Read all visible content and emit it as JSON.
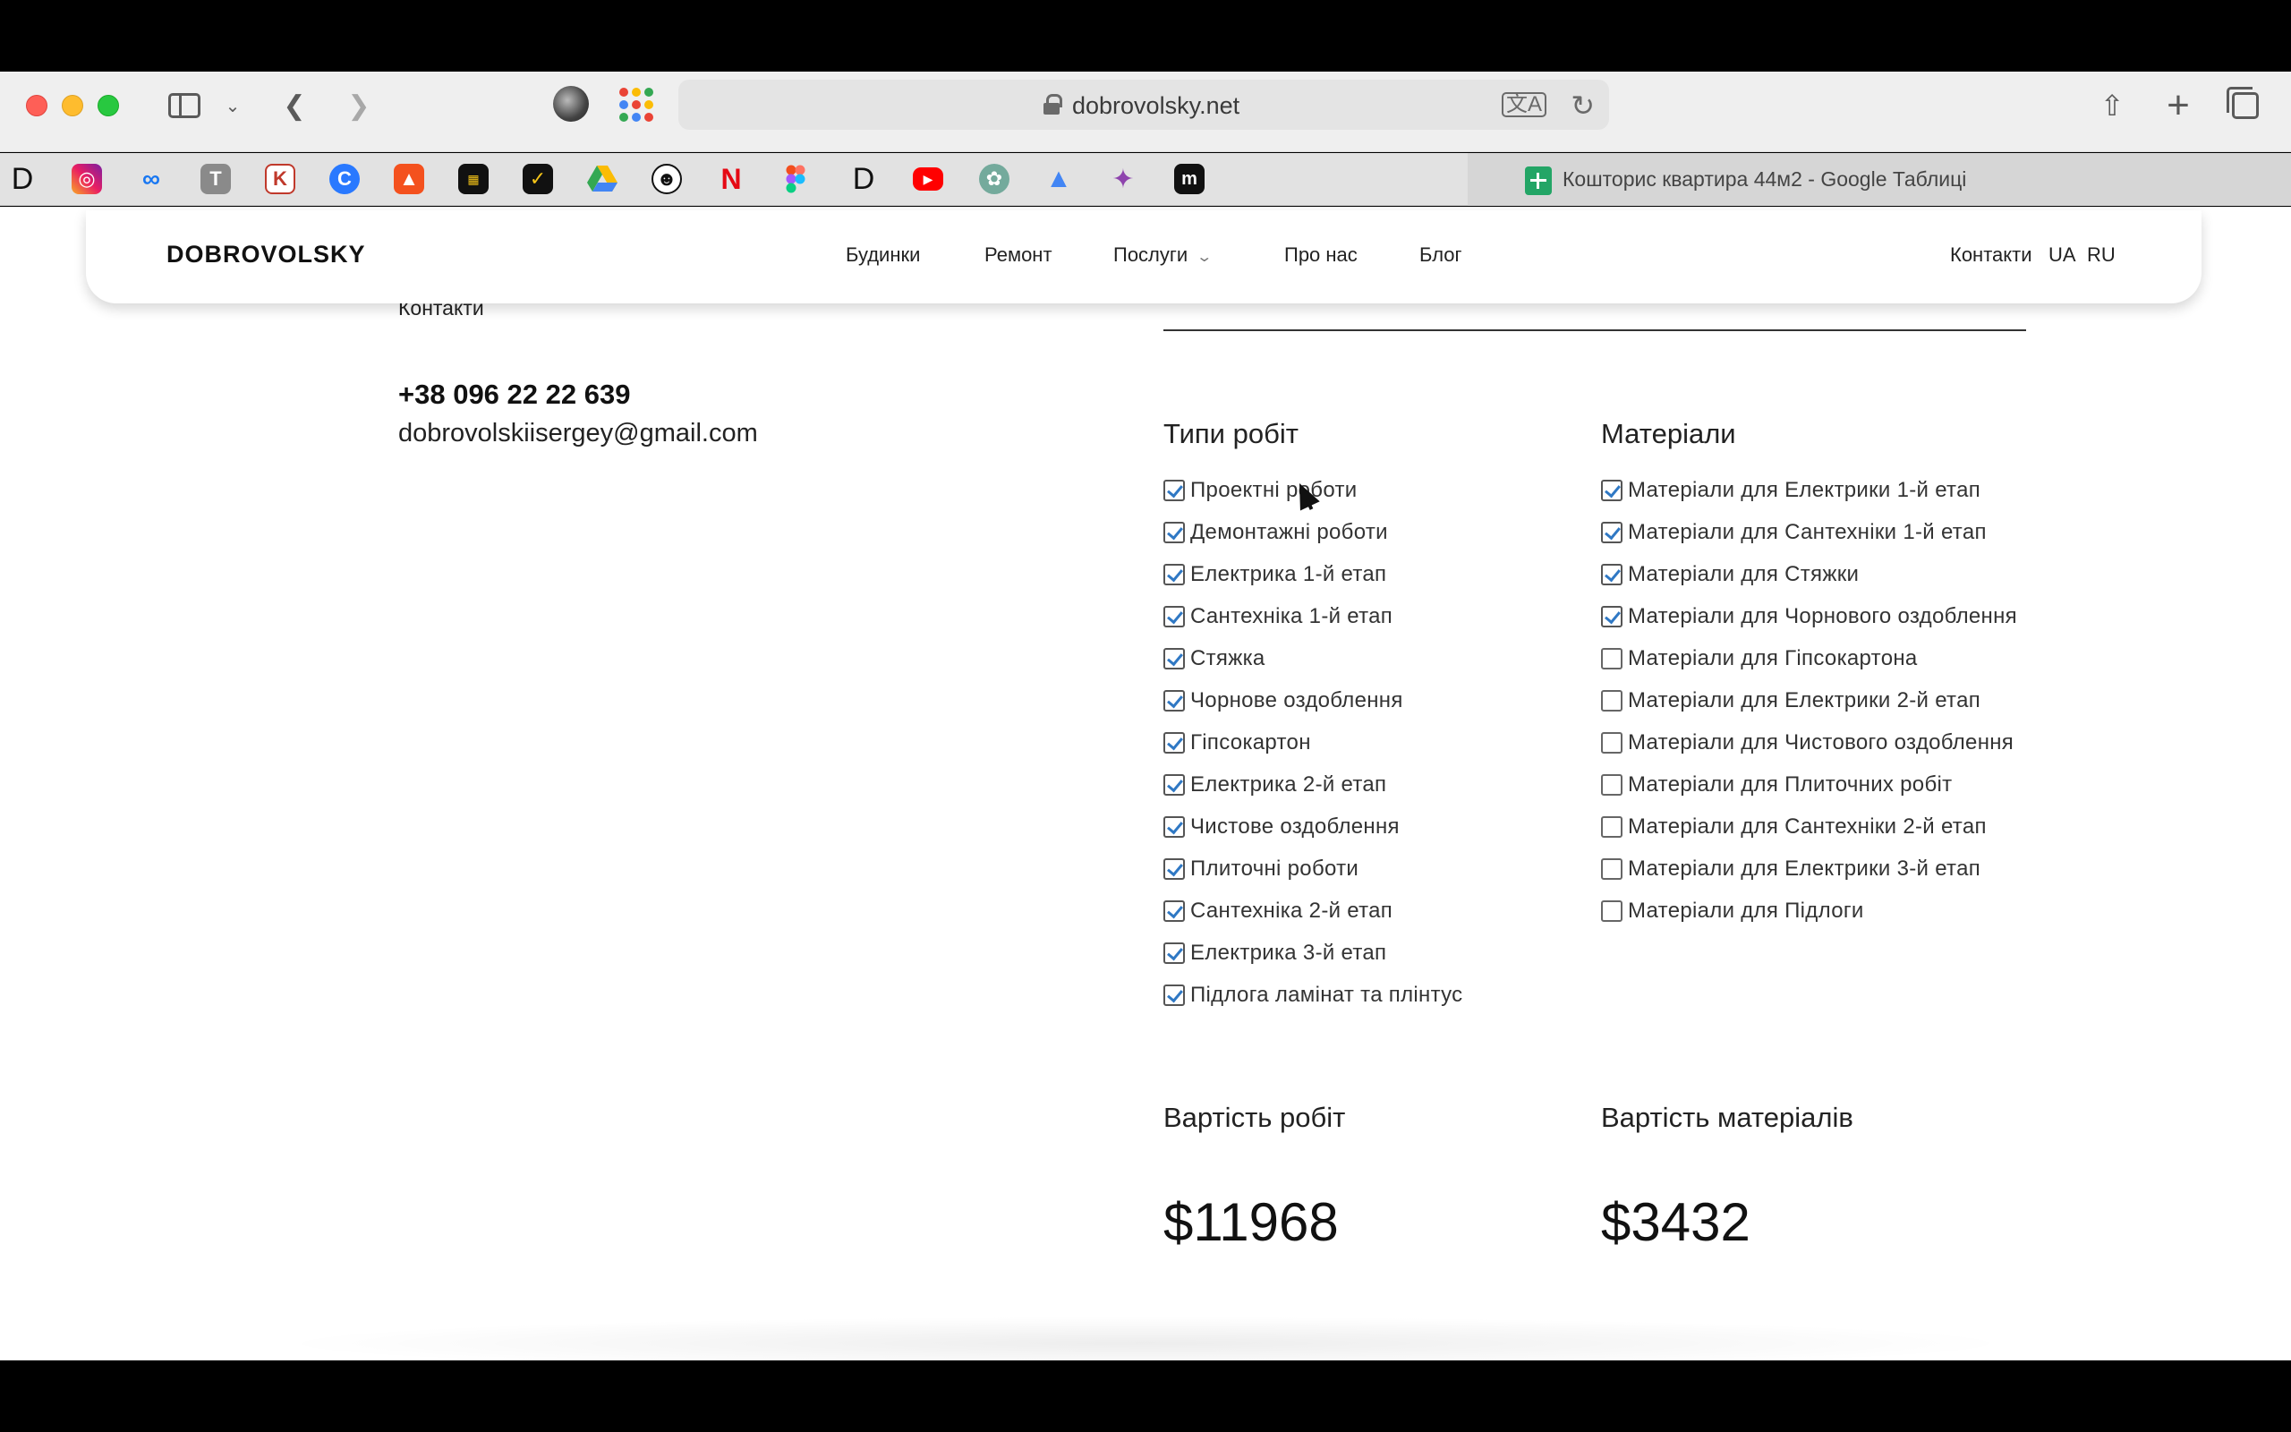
{
  "browser": {
    "url": "dobrovolsky.net",
    "active_tab_title": "Кошторис квартира 44м2 - Google Таблиці",
    "tab_favicons": [
      "D",
      "instagram",
      "meta",
      "T",
      "K",
      "C",
      "A",
      "film",
      "check",
      "drive",
      "avatar",
      "N",
      "figma",
      "D",
      "youtube",
      "chatgpt",
      "ads",
      "sparkle",
      "m"
    ]
  },
  "site": {
    "logo": "DOBROVOLSKY",
    "nav": [
      "Будинки",
      "Ремонт",
      "Послуги",
      "Про нас",
      "Блог"
    ],
    "right_nav": {
      "contacts": "Контакти",
      "ua": "UA",
      "ru": "RU"
    }
  },
  "contacts": {
    "label": "Контакти",
    "phone": "+38 096 22 22 639",
    "email": "dobrovolskiisergey@gmail.com"
  },
  "work_types": {
    "title": "Типи робіт",
    "items": [
      {
        "label": "Проектні роботи",
        "checked": true
      },
      {
        "label": "Демонтажні роботи",
        "checked": true
      },
      {
        "label": "Електрика 1-й етап",
        "checked": true
      },
      {
        "label": "Сантехніка 1-й етап",
        "checked": true
      },
      {
        "label": "Стяжка",
        "checked": true
      },
      {
        "label": "Чорнове оздоблення",
        "checked": true
      },
      {
        "label": "Гіпсокартон",
        "checked": true
      },
      {
        "label": "Електрика 2-й етап",
        "checked": true
      },
      {
        "label": "Чистове оздоблення",
        "checked": true
      },
      {
        "label": "Плиточні роботи",
        "checked": true
      },
      {
        "label": "Сантехніка 2-й етап",
        "checked": true
      },
      {
        "label": "Електрика 3-й етап",
        "checked": true
      },
      {
        "label": "Підлога ламінат та плінтус",
        "checked": true
      }
    ]
  },
  "materials": {
    "title": "Матеріали",
    "items": [
      {
        "label": "Матеріали для Електрики 1-й етап",
        "checked": true
      },
      {
        "label": "Матеріали для Сантехніки 1-й етап",
        "checked": true
      },
      {
        "label": "Матеріали для Стяжки",
        "checked": true
      },
      {
        "label": "Матеріали для Чорнового оздоблення",
        "checked": true
      },
      {
        "label": "Матеріали для Гіпсокартона",
        "checked": false
      },
      {
        "label": "Матеріали для Електрики 2-й етап",
        "checked": false
      },
      {
        "label": "Матеріали для Чистового оздоблення",
        "checked": false
      },
      {
        "label": "Матеріали для Плиточних робіт",
        "checked": false
      },
      {
        "label": "Матеріали для Сантехніки 2-й етап",
        "checked": false
      },
      {
        "label": "Матеріали для Електрики 3-й етап",
        "checked": false
      },
      {
        "label": "Матеріали для Підлоги",
        "checked": false
      }
    ]
  },
  "costs": {
    "work_title": "Вартість робіт",
    "work_value": "$11968",
    "materials_title": "Вартість матеріалів",
    "materials_value": "$3432"
  },
  "colors": {
    "checkmark": "#2f78c4",
    "page_bg": "#ffffff",
    "chrome_bg": "#efefef"
  }
}
